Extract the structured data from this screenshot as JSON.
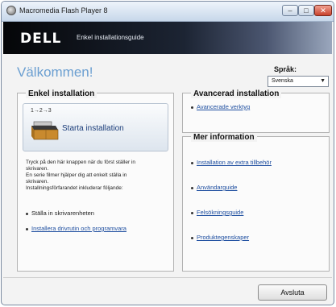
{
  "window": {
    "title": "Macromedia Flash Player 8"
  },
  "header": {
    "logo": "DELL",
    "subtitle": "Enkel installationsguide"
  },
  "welcome": "Välkommen!",
  "language": {
    "label": "Språk:",
    "value": "Svenska"
  },
  "left_panel": {
    "title": "Enkel installation",
    "install_button": {
      "steps": "1→2→3",
      "label": "Starta installation",
      "icon": "printer-box-icon"
    },
    "description_lines": [
      "Tryck på den här knappen när du först ställer in",
      "skrivaren.",
      "En serie filmer hjälper dig att enkelt ställa in",
      "skrivaren.",
      "Installningsförfarandet inkluderar följande:"
    ],
    "items": [
      {
        "label": "Ställa in skrivarenheten",
        "link": false
      },
      {
        "label": "Installera drivrutin och programvara",
        "link": true
      }
    ]
  },
  "advanced_panel": {
    "title": "Avancerad installation",
    "links": [
      "Avancerade verktyg"
    ]
  },
  "more_info_panel": {
    "title": "Mer information",
    "links": [
      "Installation av extra tillbehör",
      "Användarguide",
      "Felsökningsguide",
      "Produktegenskaper"
    ]
  },
  "footer": {
    "exit_label": "Avsluta"
  },
  "colors": {
    "welcome": "#6b9fd1",
    "link": "#1f4fa0",
    "header_dark": "#050608"
  }
}
